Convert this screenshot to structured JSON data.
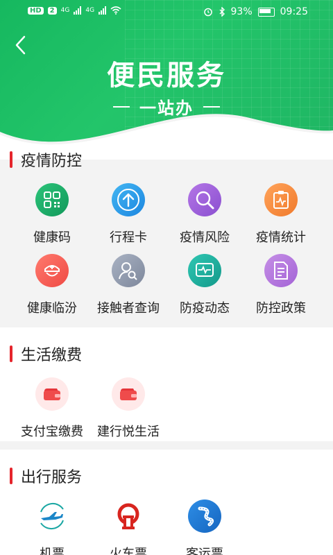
{
  "status_bar": {
    "left_badge": "HD",
    "left_badge_2": "2",
    "net_1": "4G",
    "net_2": "4G",
    "battery": "93%",
    "time": "09:25"
  },
  "header": {
    "title": "便民服务",
    "subtitle": "一站办"
  },
  "sections": [
    {
      "title": "疫情防控",
      "items": [
        {
          "label": "健康码",
          "icon": "qr-code-icon"
        },
        {
          "label": "行程卡",
          "icon": "arrow-up-icon"
        },
        {
          "label": "疫情风险",
          "icon": "search-icon"
        },
        {
          "label": "疫情统计",
          "icon": "clipboard-chart-icon"
        },
        {
          "label": "健康临汾",
          "icon": "nurse-cap-icon"
        },
        {
          "label": "接触者查询",
          "icon": "person-search-icon"
        },
        {
          "label": "防疫动态",
          "icon": "heartbeat-monitor-icon"
        },
        {
          "label": "防控政策",
          "icon": "document-icon"
        }
      ]
    },
    {
      "title": "生活缴费",
      "items": [
        {
          "label": "支付宝缴费",
          "icon": "wallet-icon"
        },
        {
          "label": "建行悦生活",
          "icon": "wallet-icon"
        }
      ]
    },
    {
      "title": "出行服务",
      "items": [
        {
          "label": "机票",
          "icon": "airplane-icon"
        },
        {
          "label": "火车票",
          "icon": "train-icon"
        },
        {
          "label": "客运票",
          "icon": "bus-road-icon"
        }
      ]
    }
  ],
  "colors": {
    "header_green": "#1fb563",
    "section_bar_red": "#e5252c"
  }
}
